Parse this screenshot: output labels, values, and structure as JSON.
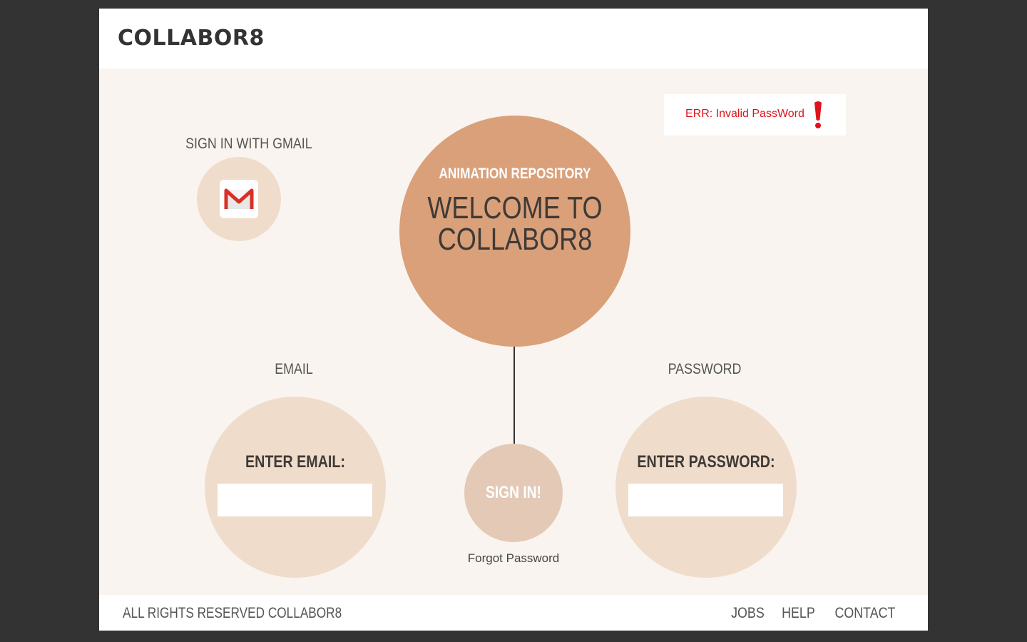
{
  "header": {
    "brand": "COLLABOR8"
  },
  "error": {
    "message": "ERR: Invalid PassWord",
    "icon": "exclamation-icon",
    "color": "#e0131b"
  },
  "gmail": {
    "label": "SIGN IN WITH GMAIL",
    "icon": "gmail-icon"
  },
  "hero": {
    "subtitle": "ANIMATION REPOSITORY",
    "title_line1": "WELCOME TO",
    "title_line2": "COLLABOR8"
  },
  "email": {
    "label": "EMAIL",
    "caption": "ENTER EMAIL:",
    "value": ""
  },
  "password": {
    "label": "PASSWORD",
    "caption": "ENTER PASSWORD:",
    "value": ""
  },
  "signin": {
    "label": "SIGN IN!",
    "forgot": "Forgot Password"
  },
  "footer": {
    "copyright": "ALL RIGHTS RESERVED COLLABOR8",
    "links": [
      "JOBS",
      "HELP",
      "CONTACT"
    ]
  },
  "colors": {
    "background_outer": "#333333",
    "content_bg": "#f9f4ef",
    "hero_circle": "#d9a07a",
    "field_circle": "#f0dccb",
    "signin_circle": "#e3c9b6"
  }
}
